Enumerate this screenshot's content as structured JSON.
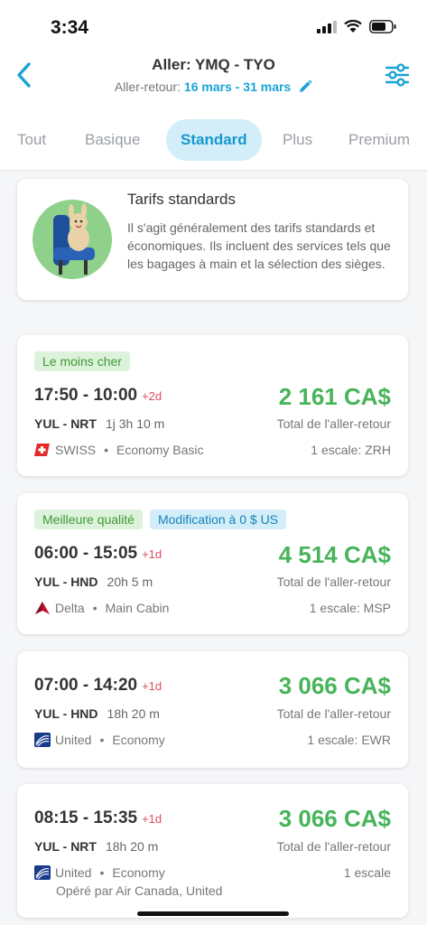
{
  "status_bar": {
    "time": "3:34"
  },
  "header": {
    "title": "Aller: YMQ - TYO",
    "subtitle_prefix": "Aller-retour:",
    "dates": "16 mars - 31 mars"
  },
  "tabs": [
    {
      "label": "Tout",
      "active": false
    },
    {
      "label": "Basique",
      "active": false
    },
    {
      "label": "Standard",
      "active": true
    },
    {
      "label": "Plus",
      "active": false
    },
    {
      "label": "Premium",
      "active": false
    }
  ],
  "info": {
    "title": "Tarifs standards",
    "text": "Il s'agit généralement des tarifs standards et économiques. Ils incluent des services tels que les bagages à main et la sélection des sièges."
  },
  "flights": [
    {
      "badges": [
        "Le moins cher"
      ],
      "times": "17:50 - 10:00",
      "plus_days": "+2d",
      "price": "2 161 CA$",
      "route": "YUL - NRT",
      "duration": "1j 3h 10 m",
      "total": "Total de l'aller-retour",
      "airline": "SWISS",
      "cabin": "Economy Basic",
      "stops": "1 escale: ZRH",
      "logo": "swiss-logo-icon"
    },
    {
      "badges": [
        "Meilleure qualité",
        "Modification à 0 $ US"
      ],
      "times": "06:00 - 15:05",
      "plus_days": "+1d",
      "price": "4 514 CA$",
      "route": "YUL - HND",
      "duration": "20h 5 m",
      "total": "Total de l'aller-retour",
      "airline": "Delta",
      "cabin": "Main Cabin",
      "stops": "1 escale: MSP",
      "logo": "delta-logo-icon"
    },
    {
      "badges": [],
      "times": "07:00 - 14:20",
      "plus_days": "+1d",
      "price": "3 066 CA$",
      "route": "YUL - HND",
      "duration": "18h 20 m",
      "total": "Total de l'aller-retour",
      "airline": "United",
      "cabin": "Economy",
      "stops": "1 escale: EWR",
      "logo": "united-logo-icon"
    },
    {
      "badges": [],
      "times": "08:15 - 15:35",
      "plus_days": "+1d",
      "price": "3 066 CA$",
      "route": "YUL - NRT",
      "duration": "18h 20 m",
      "total": "Total de l'aller-retour",
      "airline": "United",
      "cabin": "Economy",
      "stops": "1 escale",
      "operated_by": "Opéré par Air Canada, United",
      "logo": "united-logo-icon"
    }
  ],
  "colors": {
    "accent": "#1aa3d8",
    "price": "#47b45a",
    "plus_days": "#e04b5b"
  },
  "dot_separator": "•"
}
